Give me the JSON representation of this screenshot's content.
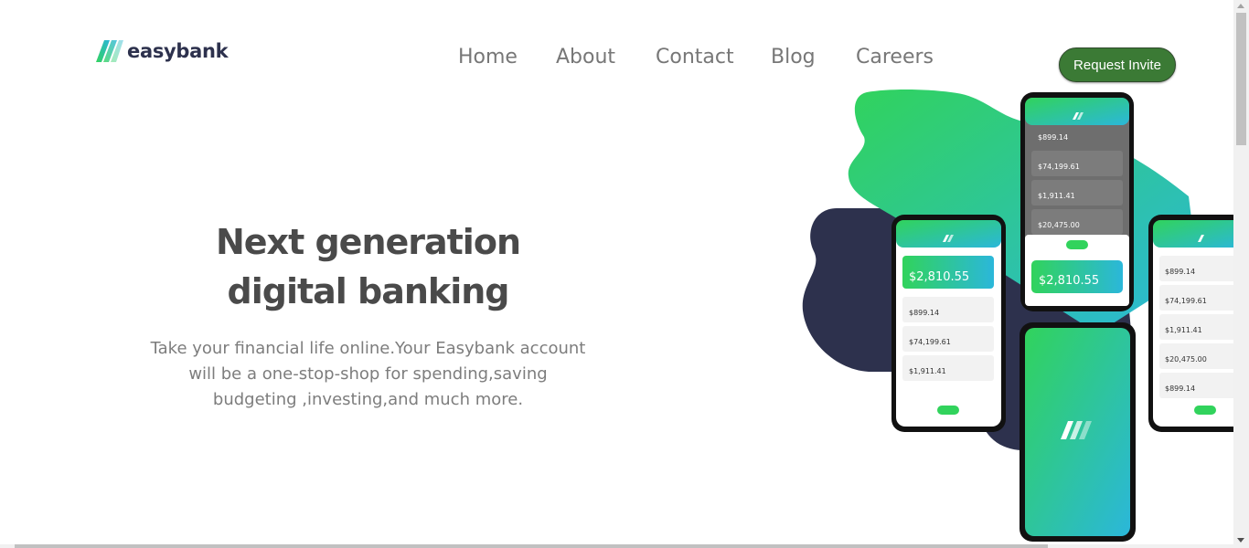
{
  "brand": {
    "name": "easybank",
    "colors": {
      "dark": "#2d314d",
      "green": "#31d35c",
      "cyan": "#2bb7da",
      "cta": "#3b7a35"
    }
  },
  "nav": {
    "items": [
      {
        "label": "Home"
      },
      {
        "label": "About"
      },
      {
        "label": "Contact"
      },
      {
        "label": "Blog"
      },
      {
        "label": "Careers"
      }
    ]
  },
  "cta": {
    "label": "Request Invite"
  },
  "hero": {
    "title_line1": "Next generation",
    "title_line2": "digital banking",
    "subtitle_line1": "Take your financial life online.Your Easybank account",
    "subtitle_line2": "will be a one-stop-shop for spending,saving",
    "subtitle_line3": "budgeting ,investing,and much more."
  },
  "phones": {
    "total_balance": "$2,810.55",
    "accounts": [
      "$899.14",
      "$74,199.61",
      "$1,911.41",
      "$20,475.00"
    ]
  }
}
